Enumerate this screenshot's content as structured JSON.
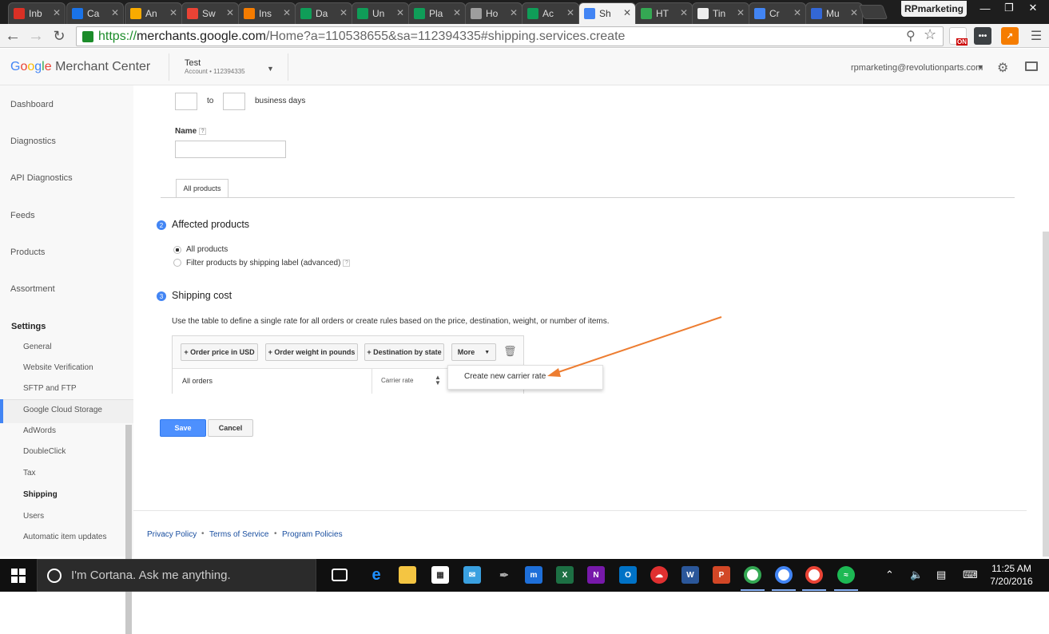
{
  "browser": {
    "tabs": [
      {
        "label": "Inb",
        "color": "#d93025"
      },
      {
        "label": "Ca",
        "color": "#1a73e8"
      },
      {
        "label": "An",
        "color": "#f9ab00"
      },
      {
        "label": "Sw",
        "color": "#ea4335"
      },
      {
        "label": "Ins",
        "color": "#f57c00"
      },
      {
        "label": "Da",
        "color": "#0f9d58"
      },
      {
        "label": "Un",
        "color": "#0f9d58"
      },
      {
        "label": "Pla",
        "color": "#0f9d58"
      },
      {
        "label": "Ho",
        "color": "#9e9e9e"
      },
      {
        "label": "Ac",
        "color": "#0f9d58"
      },
      {
        "label": "Sh",
        "color": "#4285f4"
      },
      {
        "label": "HT",
        "color": "#34a853"
      },
      {
        "label": "Tin",
        "color": "#eeeeee"
      },
      {
        "label": "Cr",
        "color": "#4285f4"
      },
      {
        "label": "Mu",
        "color": "#3367d6"
      }
    ],
    "active_tab": 10,
    "profile": "RPmarketing",
    "url_scheme": "https://",
    "url_host": "merchants.google.com",
    "url_path": "/Home?a=110538655&sa=112394335#shipping.services.create",
    "ext_on_label": "ON"
  },
  "header": {
    "logo_google": "Google",
    "logo_product": "Merchant Center",
    "account_name": "Test",
    "account_sub": "Account  •  112394335",
    "email": "rpmarketing@revolutionparts.com"
  },
  "sidebar": {
    "items": [
      "Dashboard",
      "Diagnostics",
      "API Diagnostics",
      "Feeds",
      "Products",
      "Assortment",
      "Settings"
    ],
    "subitems": [
      "General",
      "Website Verification",
      "SFTP and FTP",
      "Google Cloud Storage",
      "AdWords",
      "DoubleClick",
      "Tax",
      "Shipping",
      "Users",
      "Automatic item updates"
    ]
  },
  "form": {
    "to_label": "to",
    "business_days": "business days",
    "name_label": "Name",
    "name_value": "",
    "all_products_tab": "All products",
    "section2_num": "2",
    "section2_title": "Affected products",
    "radio_all": "All products",
    "radio_filter": "Filter products by shipping label (advanced)",
    "section3_num": "3",
    "section3_title": "Shipping cost",
    "shipping_desc": "Use the table to define a single rate for all orders or create rules based on the price, destination, weight, or number of items.",
    "btn_price": "+ Order price in USD",
    "btn_weight": "+ Order weight in pounds",
    "btn_dest": "+ Destination by state",
    "btn_more": "More",
    "row_label": "All orders",
    "rate_select": "Carrier rate",
    "dropdown_option": "Create new carrier rate",
    "save": "Save",
    "cancel": "Cancel"
  },
  "footer": {
    "links": [
      "Privacy Policy",
      "Terms of Service",
      "Program Policies"
    ]
  },
  "taskbar": {
    "cortana": "I'm Cortana. Ask me anything.",
    "time": "11:25 AM",
    "date": "7/20/2016"
  }
}
